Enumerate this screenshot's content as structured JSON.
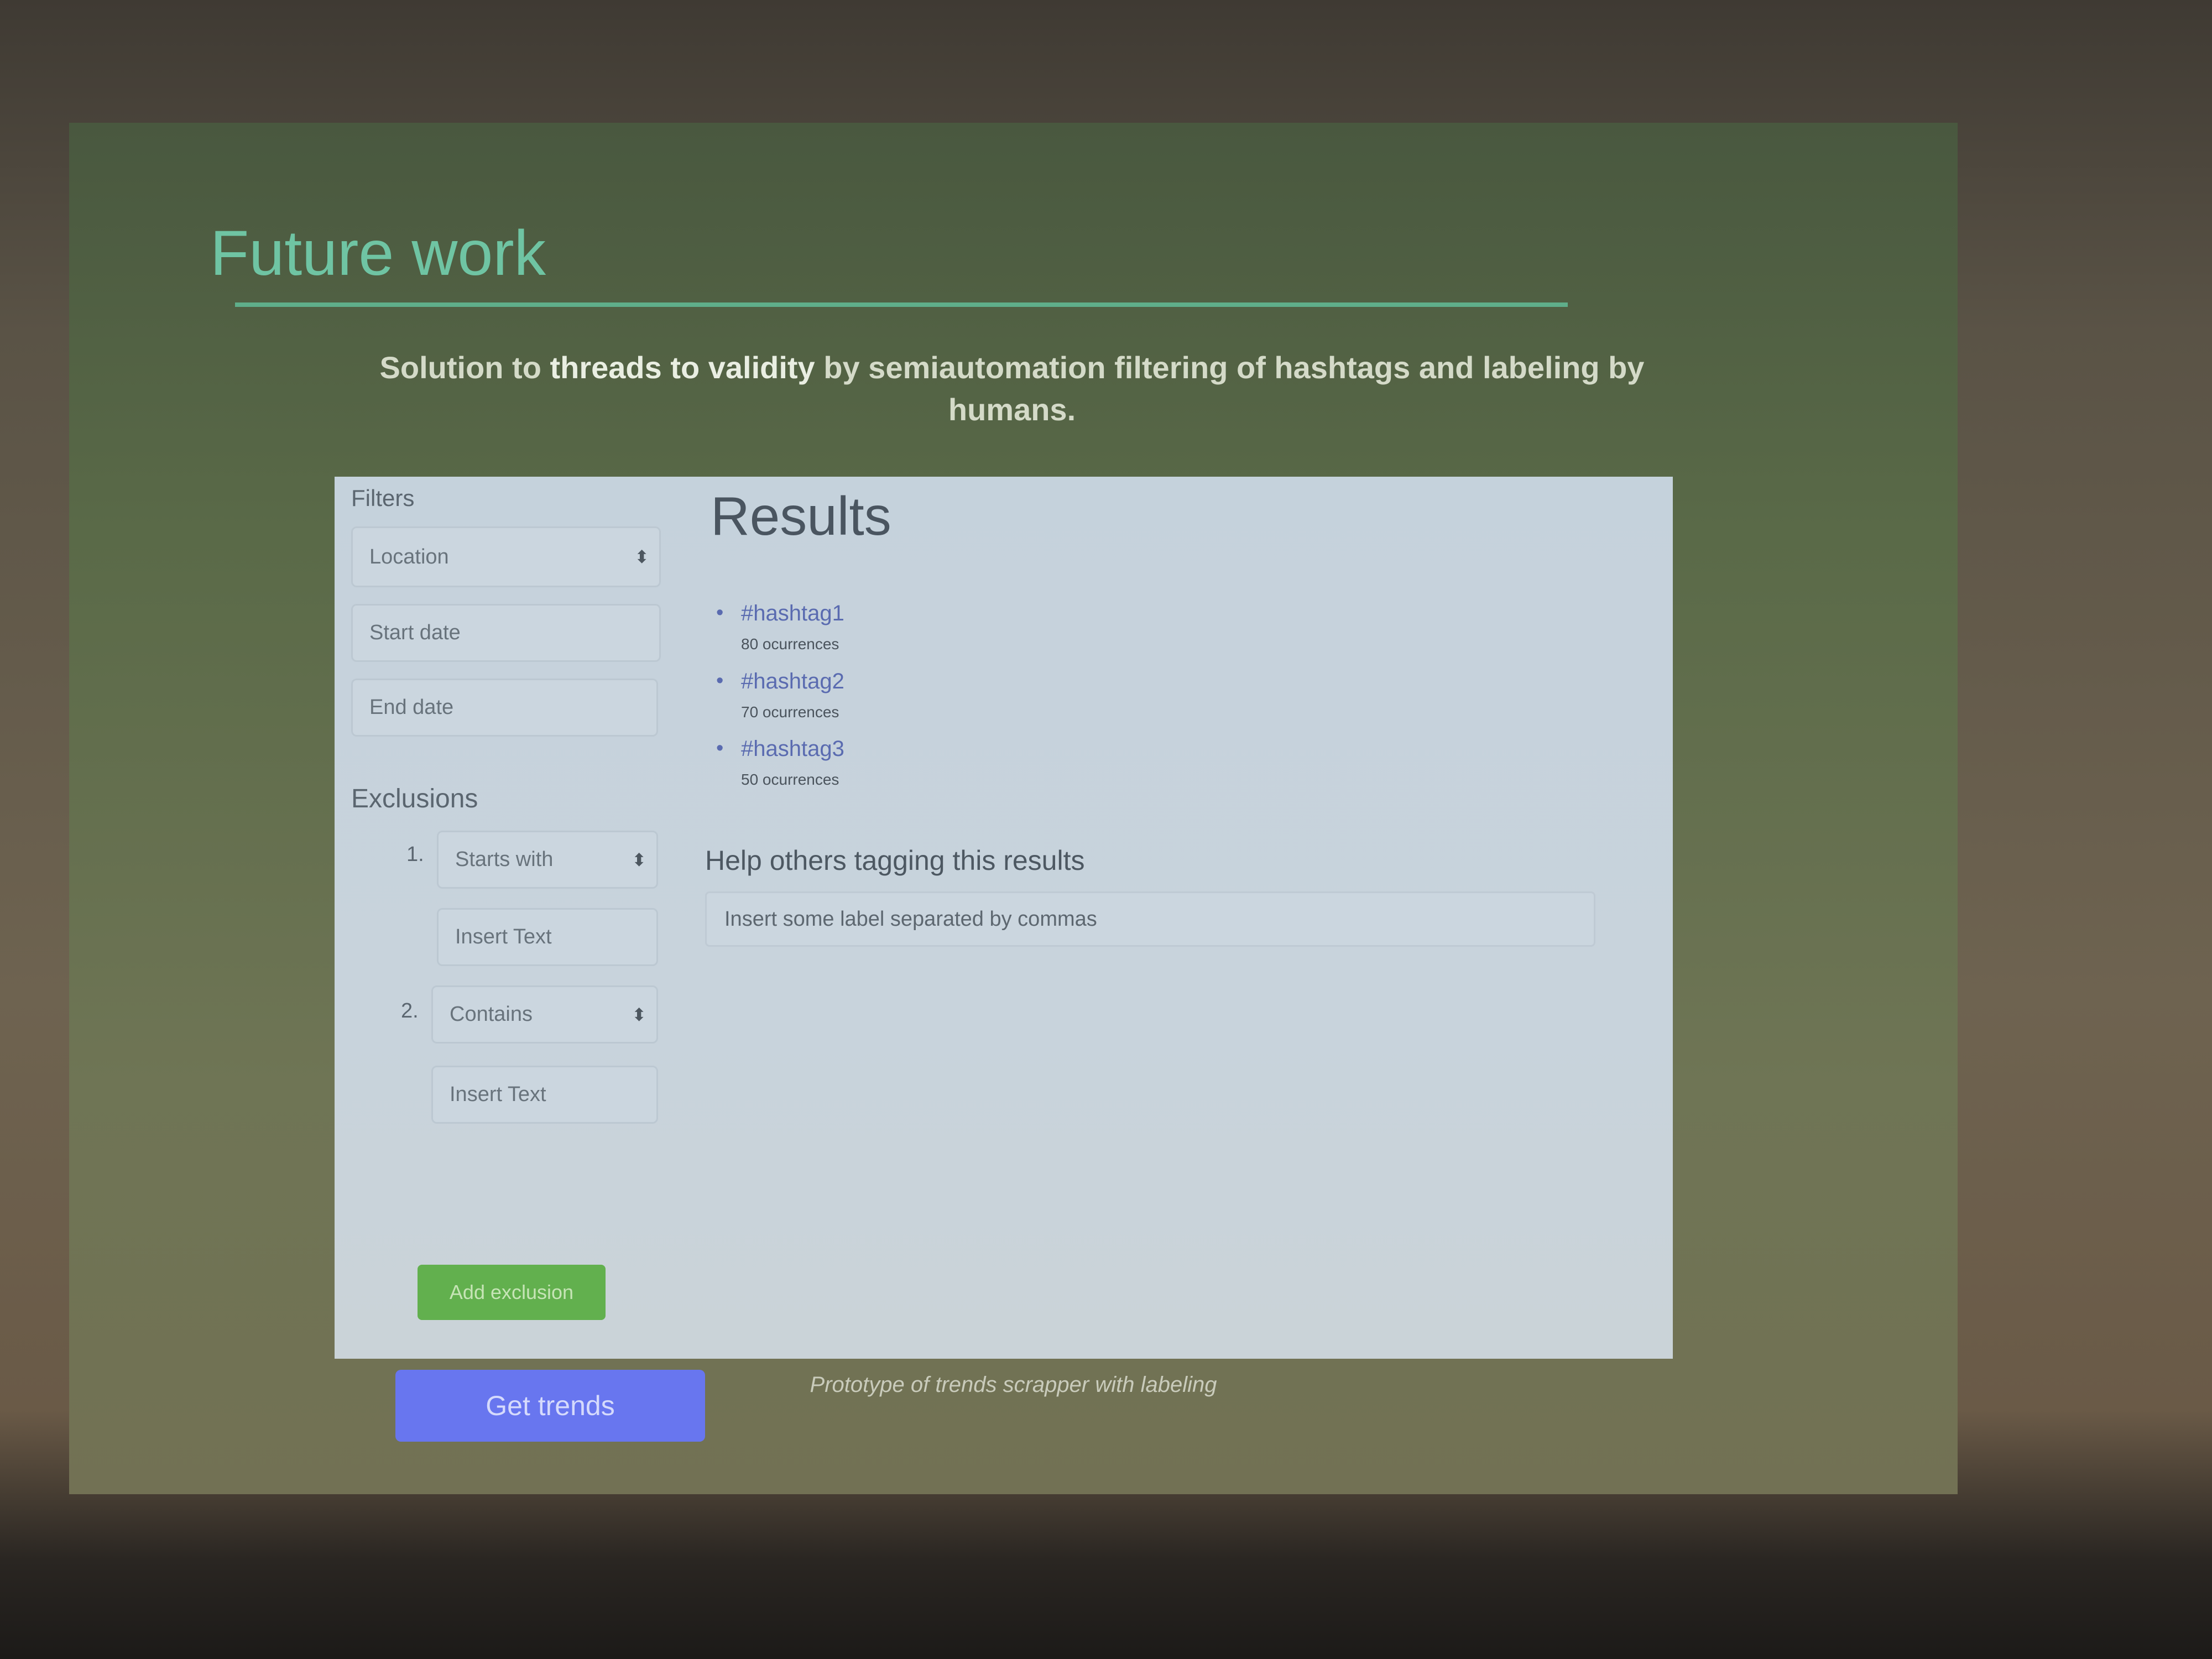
{
  "slide": {
    "title": "Future work",
    "subtitle_parts": [
      "Solution to ",
      "threads to validity",
      " by semiautomation filtering of hashtags and labeling by humans."
    ],
    "caption": "Prototype of trends scrapper with labeling"
  },
  "app": {
    "filters": {
      "heading": "Filters",
      "location": "Location",
      "start_date_placeholder": "Start date",
      "end_date_placeholder": "End date"
    },
    "exclusions": {
      "heading": "Exclusions",
      "items": [
        {
          "number": "1.",
          "type": "Starts with",
          "text_placeholder": "Insert Text"
        },
        {
          "number": "2.",
          "type": "Contains",
          "text_placeholder": "Insert Text"
        }
      ],
      "add_label": "Add exclusion"
    },
    "get_trends_label": "Get trends",
    "results": {
      "title": "Results",
      "items": [
        {
          "tag": "#hashtag1",
          "count": "80 ocurrences"
        },
        {
          "tag": "#hashtag2",
          "count": "70 ocurrences"
        },
        {
          "tag": "#hashtag3",
          "count": "50 ocurrences"
        }
      ]
    },
    "tagging": {
      "heading": "Help others tagging this results",
      "placeholder": "Insert some label separated by commas"
    }
  },
  "icons": {
    "select_chevron": "up-down-chevron-icon",
    "list_bullet": "bullet-icon"
  },
  "colors": {
    "title": "#6fc4a3",
    "add_button": "#62b04e",
    "get_trends_button": "#6876ef",
    "hashtag_link": "#5a6bb0"
  }
}
